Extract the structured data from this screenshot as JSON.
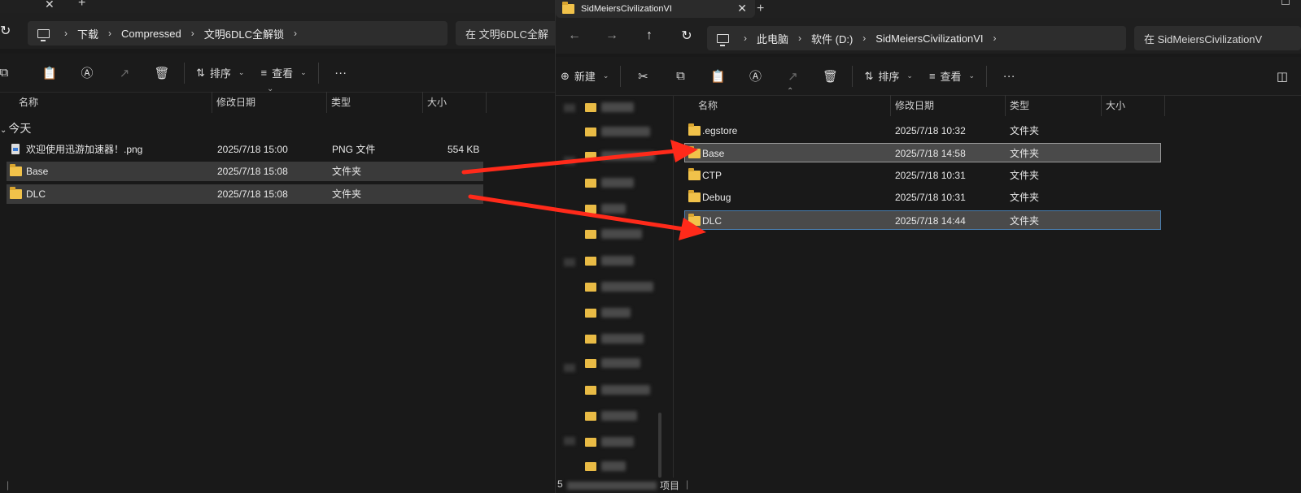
{
  "left": {
    "tab": {
      "close": "✕",
      "add": "+"
    },
    "nav": {
      "refresh": "↻"
    },
    "address": {
      "segments": [
        "下载",
        "Compressed",
        "文明6DLC全解锁"
      ]
    },
    "search": {
      "placeholder": "在 文明6DLC全解"
    },
    "toolbar": {
      "sort": "排序",
      "view": "查看",
      "more": "···"
    },
    "columns": {
      "name": "名称",
      "date": "修改日期",
      "type": "类型",
      "size": "大小"
    },
    "group": "今天",
    "files": [
      {
        "name": "欢迎使用迅游加速器！.png",
        "date": "2025/7/18 15:00",
        "type": "PNG 文件",
        "size": "554 KB",
        "kind": "png"
      },
      {
        "name": "Base",
        "date": "2025/7/18 15:08",
        "type": "文件夹",
        "size": "",
        "kind": "folder"
      },
      {
        "name": "DLC",
        "date": "2025/7/18 15:08",
        "type": "文件夹",
        "size": "",
        "kind": "folder"
      }
    ]
  },
  "right": {
    "tab": {
      "title": "SidMeiersCivilizationVI",
      "close": "✕",
      "add": "+"
    },
    "nav": {
      "back": "←",
      "forward": "→",
      "up": "↑",
      "refresh": "↻"
    },
    "address": {
      "segments": [
        "此电脑",
        "软件 (D:)",
        "SidMeiersCivilizationVI"
      ]
    },
    "search": {
      "placeholder": "在 SidMeiersCivilizationV"
    },
    "toolbar": {
      "new": "新建",
      "sort": "排序",
      "view": "查看",
      "more": "···"
    },
    "columns": {
      "name": "名称",
      "date": "修改日期",
      "type": "类型",
      "size": "大小"
    },
    "files": [
      {
        "name": ".egstore",
        "date": "2025/7/18 10:32",
        "type": "文件夹"
      },
      {
        "name": "Base",
        "date": "2025/7/18 14:58",
        "type": "文件夹"
      },
      {
        "name": "CTP",
        "date": "2025/7/18 10:31",
        "type": "文件夹"
      },
      {
        "name": "Debug",
        "date": "2025/7/18 10:31",
        "type": "文件夹"
      },
      {
        "name": "DLC",
        "date": "2025/7/18 14:44",
        "type": "文件夹"
      }
    ],
    "status": {
      "count_prefix": "5",
      "items_suffix": "项目"
    }
  },
  "colors": {
    "accent_arrow": "#ff2a1a",
    "folder": "#f1c24a",
    "selection_blue": "#4a7fb0"
  }
}
